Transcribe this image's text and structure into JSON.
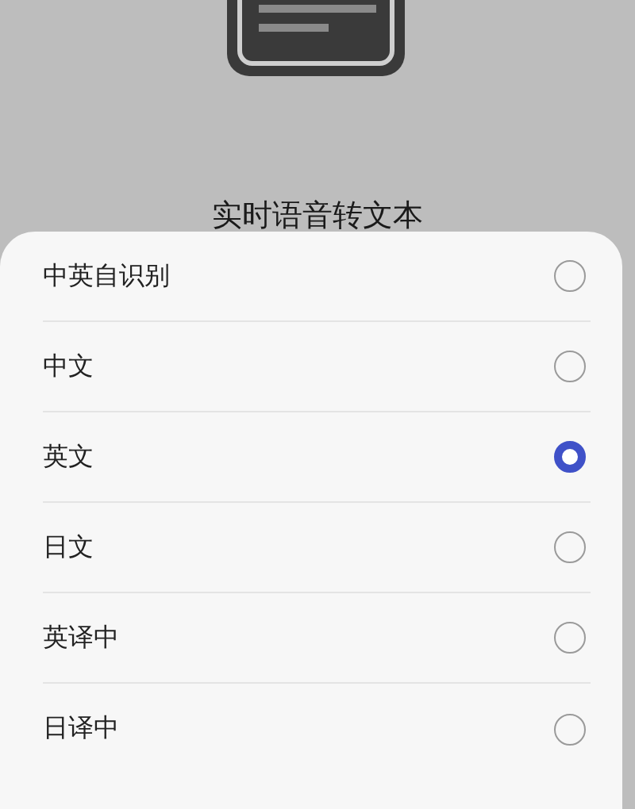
{
  "title": "实时语音转文本",
  "options": [
    {
      "label": "中英自识别",
      "selected": false
    },
    {
      "label": "中文",
      "selected": false
    },
    {
      "label": "英文",
      "selected": true
    },
    {
      "label": "日文",
      "selected": false
    },
    {
      "label": "英译中",
      "selected": false
    },
    {
      "label": "日译中",
      "selected": false
    }
  ]
}
